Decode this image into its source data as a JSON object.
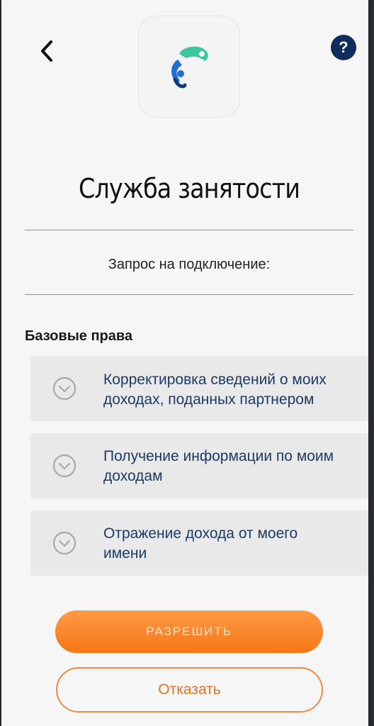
{
  "header": {
    "back_icon": "chevron-left-icon",
    "help_label": "?",
    "logo_icon": "employment-service-logo"
  },
  "title": "Служба занятости",
  "request_text": "Запрос на подключение:",
  "rights_heading": "Базовые права",
  "permissions": [
    {
      "line1": "Корректировка сведений о моих",
      "line2": "доходах, поданных партнером",
      "icon": "chevron-down-circle-icon"
    },
    {
      "line1": "Получение информации по моим",
      "line2": "доходам",
      "icon": "chevron-down-circle-icon"
    },
    {
      "line1": "Отражение дохода от моего",
      "line2": "имени",
      "icon": "chevron-down-circle-icon"
    }
  ],
  "actions": {
    "allow_label": "РАЗРЕШИТЬ",
    "deny_label": "Отказать"
  },
  "colors": {
    "accent": "#f57616",
    "help_bg": "#0f2d5c",
    "permission_text": "#1c3a66",
    "logo_blue": "#1f6fd6",
    "logo_green": "#3cc79a"
  }
}
